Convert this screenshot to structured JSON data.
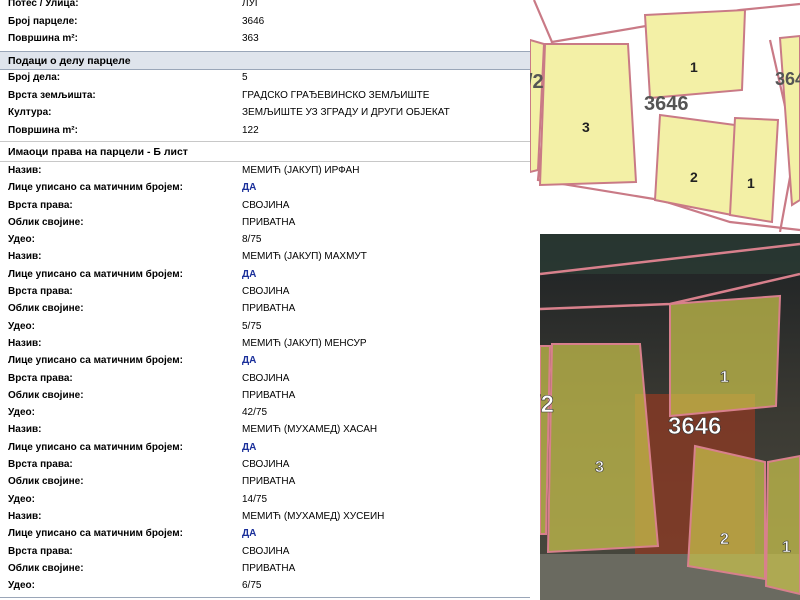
{
  "record": {
    "parcel_rows": [
      {
        "label": "Потес / Улица:",
        "value": "ЛУГ"
      },
      {
        "label": "Број парцеле:",
        "value": "3646"
      },
      {
        "label": "Површина m²:",
        "value": "363"
      }
    ],
    "part_section_title": "Подаци о делу парцеле",
    "part_rows": [
      {
        "label": "Број дела:",
        "value": "5"
      },
      {
        "label": "Врста земљишта:",
        "value": "ГРАДСКО ГРАЂЕВИНСКО ЗЕМЉИШТЕ"
      },
      {
        "label": "Култура:",
        "value": "ЗЕМЉИШТЕ УЗ ЗГРАДУ И ДРУГИ ОБЈЕКАТ"
      },
      {
        "label": "Површина m²:",
        "value": "122"
      }
    ],
    "owners_section_title": "Имаоци права на парцели - Б лист",
    "owners": [
      {
        "name_label": "Назив:",
        "name": "МЕМИЋ (ЈАКУП) ИРФАН",
        "registered_label": "Лице уписано са матичним бројем:",
        "registered": "ДА",
        "right_type_label": "Врста права:",
        "right_type": "СВОЈИНА",
        "ownership_form_label": "Облик својине:",
        "ownership_form": "ПРИВАТНА",
        "share_label": "Удео:",
        "share": "8/75"
      },
      {
        "name_label": "Назив:",
        "name": "МЕМИЋ (ЈАКУП) МАХМУТ",
        "registered_label": "Лице уписано са матичним бројем:",
        "registered": "ДА",
        "right_type_label": "Врста права:",
        "right_type": "СВОЈИНА",
        "ownership_form_label": "Облик својине:",
        "ownership_form": "ПРИВАТНА",
        "share_label": "Удео:",
        "share": "5/75"
      },
      {
        "name_label": "Назив:",
        "name": "МЕМИЋ (ЈАКУП) МЕНСУР",
        "registered_label": "Лице уписано са матичним бројем:",
        "registered": "ДА",
        "right_type_label": "Врста права:",
        "right_type": "СВОЈИНА",
        "ownership_form_label": "Облик својине:",
        "ownership_form": "ПРИВАТНА",
        "share_label": "Удео:",
        "share": "42/75"
      },
      {
        "name_label": "Назив:",
        "name": "МЕМИЋ (МУХАМЕД) ХАСАН",
        "registered_label": "Лице уписано са матичним бројем:",
        "registered": "ДА",
        "right_type_label": "Врста права:",
        "right_type": "СВОЈИНА",
        "ownership_form_label": "Облик својине:",
        "ownership_form": "ПРИВАТНА",
        "share_label": "Удео:",
        "share": "14/75"
      },
      {
        "name_label": "Назив:",
        "name": "МЕМИЋ (МУХАМЕД) ХУСЕИН",
        "registered_label": "Лице уписано са матичним бројем:",
        "registered": "ДА",
        "right_type_label": "Врста права:",
        "right_type": "СВОЈИНА",
        "ownership_form_label": "Облик својине:",
        "ownership_form": "ПРИВАТНА",
        "share_label": "Удео:",
        "share": "6/75"
      }
    ]
  },
  "map_plan": {
    "parcel_number": "3646",
    "part_labels": [
      "1",
      "3",
      "2",
      "1"
    ],
    "edge_labels": [
      "/2",
      "364"
    ]
  },
  "map_ortho": {
    "parcel_number": "3646",
    "part_labels": [
      "1",
      "3",
      "2",
      "1"
    ],
    "edge_labels": [
      "/2"
    ]
  },
  "colors": {
    "section_bg": "#dfe4ec",
    "link_value": "#1a2f9a",
    "parcel_fill": "#f3f0a6",
    "parcel_border": "#c97a86"
  }
}
